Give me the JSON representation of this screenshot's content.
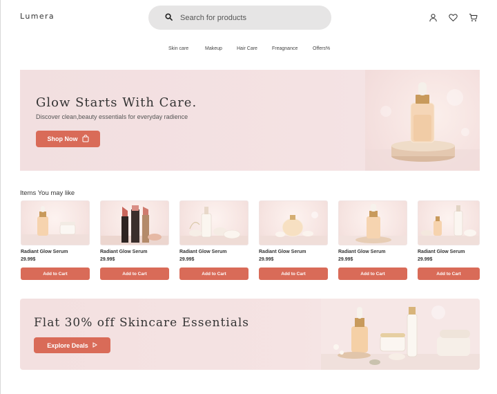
{
  "header": {
    "logo": "Lumera",
    "search_placeholder": "Search for products",
    "icons": [
      "user-icon",
      "heart-icon",
      "cart-icon"
    ]
  },
  "nav": {
    "items": [
      "Skin care",
      "Makeup",
      "Hair Care",
      "Freagnance",
      "Offers%"
    ]
  },
  "hero": {
    "title": "Glow Starts With Care.",
    "subtitle": "Discover clean,beauty essentials for everyday radience",
    "button_label": "Shop Now"
  },
  "items_section": {
    "title": "Items You may like",
    "products": [
      {
        "name": "Radiant Glow Serum",
        "price": "29.99$",
        "button": "Add to Cart"
      },
      {
        "name": "Radiant Glow Serum",
        "price": "29.99$",
        "button": "Add to Cart"
      },
      {
        "name": "Radiant Glow Serum",
        "price": "29.99$",
        "button": "Add to Cart"
      },
      {
        "name": "Radiant Glow Serum",
        "price": "29.99$",
        "button": "Add to Cart"
      },
      {
        "name": "Radiant Glow Serum",
        "price": "29.99$",
        "button": "Add to Cart"
      },
      {
        "name": "Radiant Glow Serum",
        "price": "29.99$",
        "button": "Add to Cart"
      }
    ]
  },
  "promo": {
    "title": "Flat 30% off Skincare Essentials",
    "button_label": "Explore Deals"
  },
  "colors": {
    "accent": "#d96b58",
    "banner_bg": "#f3e0e0",
    "search_bg": "#e6e5e5"
  }
}
